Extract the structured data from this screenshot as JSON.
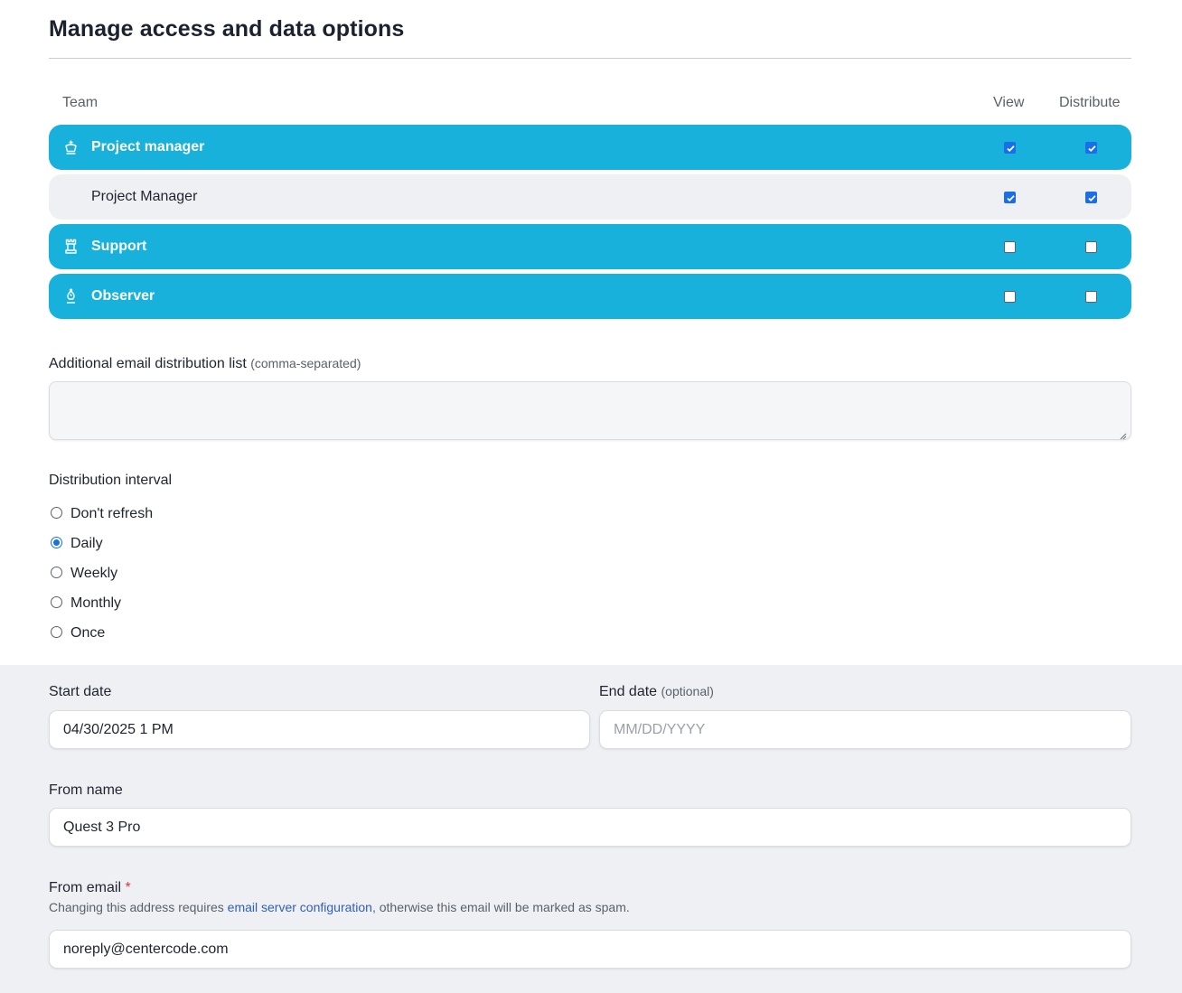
{
  "page_title": "Manage access and data options",
  "table": {
    "col_team": "Team",
    "col_view": "View",
    "col_distribute": "Distribute",
    "rows": [
      {
        "type": "group",
        "icon": "king-icon",
        "label": "Project manager",
        "view": true,
        "distribute": true
      },
      {
        "type": "member",
        "label": "Project Manager",
        "view": true,
        "distribute": true
      },
      {
        "type": "group",
        "icon": "rook-icon",
        "label": "Support",
        "view": false,
        "distribute": false
      },
      {
        "type": "group",
        "icon": "bishop-icon",
        "label": "Observer",
        "view": false,
        "distribute": false
      }
    ]
  },
  "email_list": {
    "label": "Additional email distribution list",
    "hint": "(comma-separated)",
    "value": ""
  },
  "interval": {
    "label": "Distribution interval",
    "options": [
      "Don't refresh",
      "Daily",
      "Weekly",
      "Monthly",
      "Once"
    ],
    "selected": "Daily"
  },
  "start_date": {
    "label": "Start date",
    "value": "04/30/2025 1 PM"
  },
  "end_date": {
    "label": "End date",
    "hint": "(optional)",
    "placeholder": "MM/DD/YYYY"
  },
  "from_name": {
    "label": "From name",
    "value": "Quest 3 Pro"
  },
  "from_email": {
    "label": "From email",
    "required_mark": "*",
    "help_prefix": "Changing this address requires ",
    "help_link": "email server configuration",
    "help_suffix": ", otherwise this email will be marked as spam.",
    "value": "noreply@centercode.com"
  },
  "colors": {
    "group_row": "#17b1dc",
    "member_row": "#eef0f3",
    "accent": "#1a6ee8",
    "lower_bg": "#eef0f4"
  }
}
